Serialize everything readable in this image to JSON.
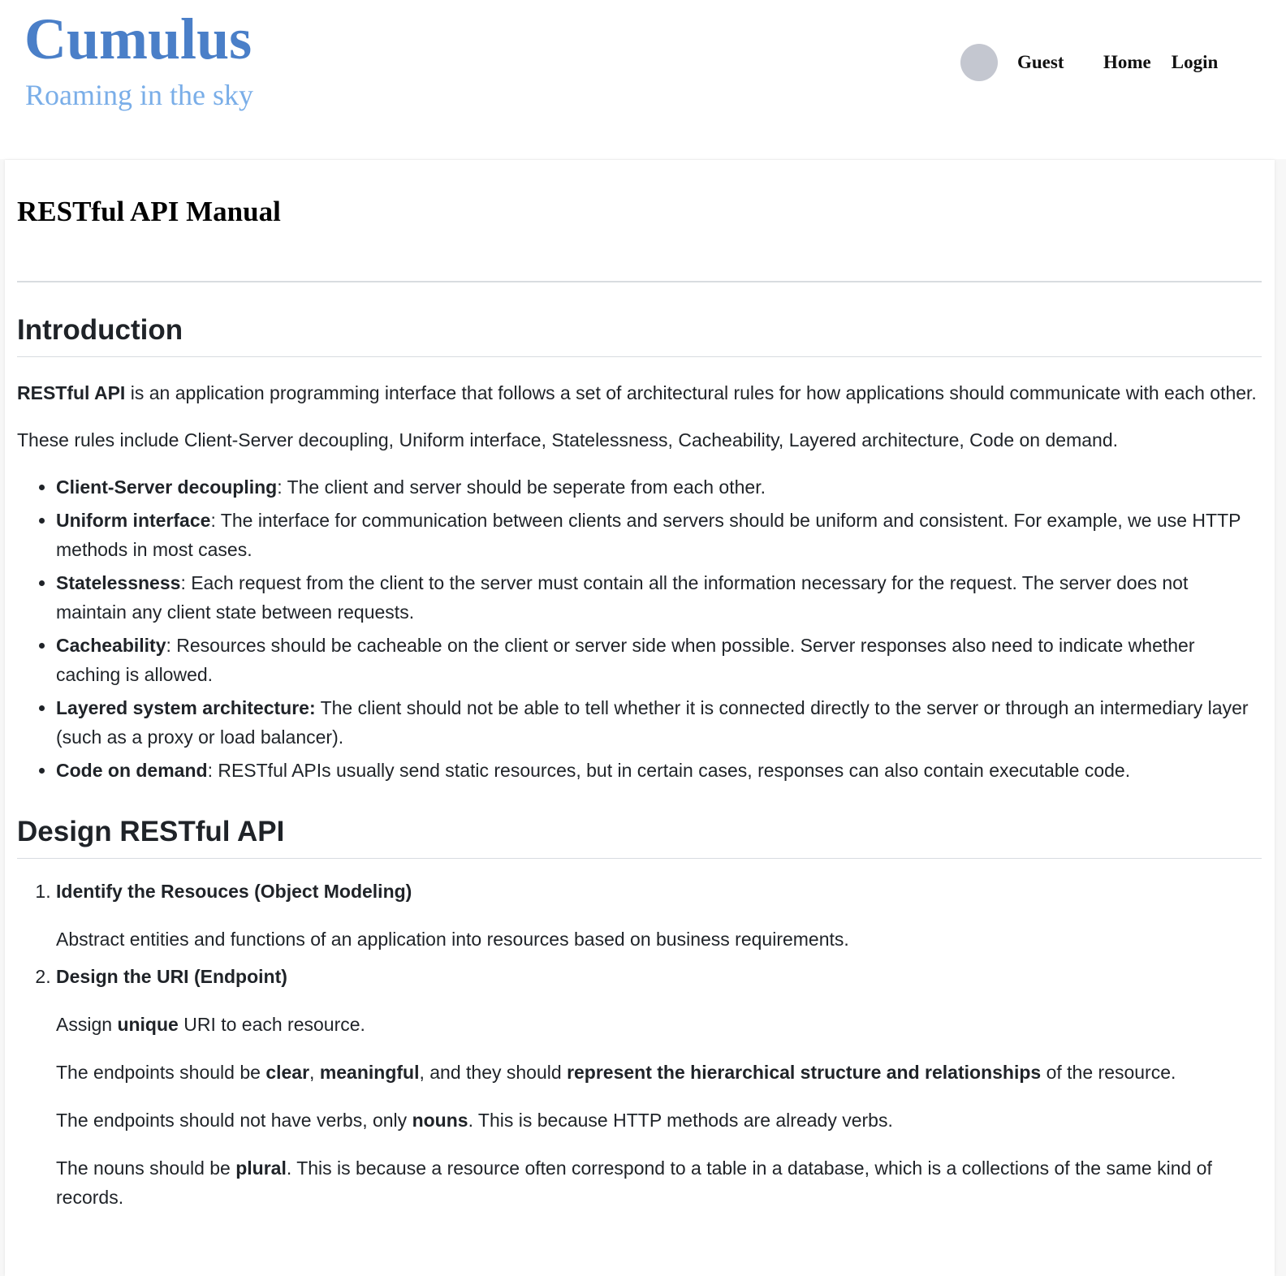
{
  "header": {
    "logo": "Cumulus",
    "tagline": "Roaming in the sky",
    "user_name": "Guest",
    "nav": {
      "home": "Home",
      "login": "Login"
    }
  },
  "article": {
    "title": "RESTful API Manual",
    "intro": {
      "heading": "Introduction",
      "p1_bold": "RESTful API",
      "p1_rest": " is an application programming interface that follows a set of architectural rules for how applications should communicate with each other.",
      "p2": "These rules include Client-Server decoupling, Uniform interface, Statelessness, Cacheability, Layered architecture, Code on demand.",
      "rules": [
        {
          "term": "Client-Server decoupling",
          "desc": ": The client and server should be seperate from each other."
        },
        {
          "term": "Uniform interface",
          "desc": ": The interface for communication between clients and servers should be uniform and consistent. For example, we use HTTP methods in most cases."
        },
        {
          "term": "Statelessness",
          "desc": ": Each request from the client to the server must contain all the information necessary for the request. The server does not maintain any client state between requests."
        },
        {
          "term": "Cacheability",
          "desc": ": Resources should be cacheable on the client or server side when possible. Server responses also need to indicate whether caching is allowed."
        },
        {
          "term": "Layered system architecture:",
          "desc": " The client should not be able to tell whether it is connected directly to the server or through an intermediary layer (such as a proxy or load balancer)."
        },
        {
          "term": "Code on demand",
          "desc": ": RESTful APIs usually send static resources, but in certain cases, responses can also contain executable code."
        }
      ]
    },
    "design": {
      "heading": "Design RESTful API",
      "step1": {
        "title": "Identify the Resouces (Object Modeling)",
        "body": "Abstract entities and functions of an application into resources based on business requirements."
      },
      "step2": {
        "title": "Design the URI (Endpoint)",
        "p1": {
          "a": "Assign ",
          "b": "unique",
          "c": " URI to each resource."
        },
        "p2": {
          "a": "The endpoints should be ",
          "b1": "clear",
          "c": ", ",
          "b2": "meaningful",
          "d": ", and they should ",
          "b3": "represent the hierarchical structure and relationships",
          "e": " of the resource."
        },
        "p3": {
          "a": "The endpoints should not have verbs, only ",
          "b": "nouns",
          "c": ". This is because HTTP methods are already verbs."
        },
        "p4": {
          "a": "The nouns should be ",
          "b": "plural",
          "c": ". This is because a resource often correspond to a table in a database, which is a collections of the same kind of records."
        }
      }
    }
  }
}
